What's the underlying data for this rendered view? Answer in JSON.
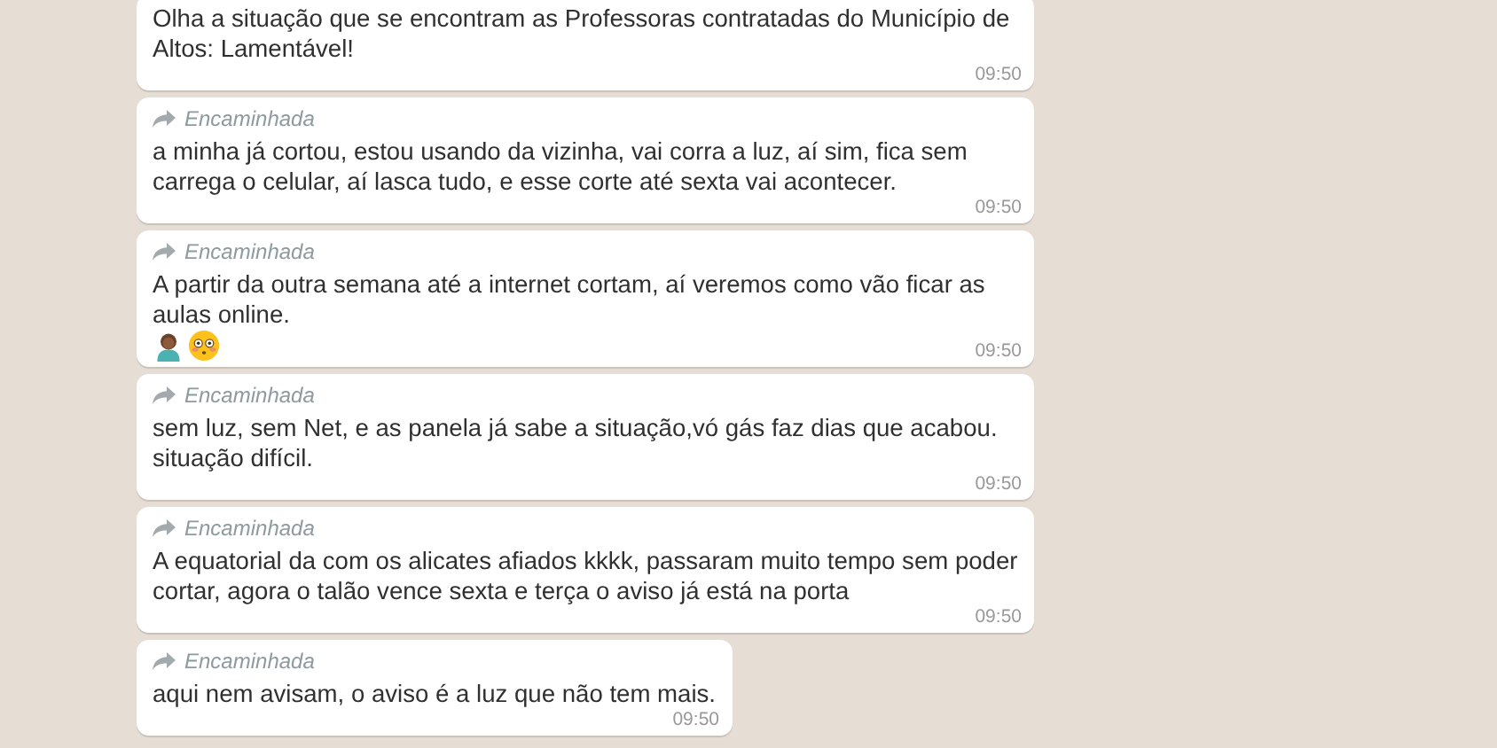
{
  "messages": [
    {
      "forwarded": false,
      "text": "Olha a situação que se encontram as Professoras contratadas do Município de Altos: Lamentável!",
      "time": "09:50",
      "has_emoji": false
    },
    {
      "forwarded": true,
      "forwarded_label": "Encaminhada",
      "text": "a minha já cortou, estou usando da vizinha, vai corra a luz, aí sim, fica sem carrega o celular,  aí lasca tudo, e esse corte até sexta vai acontecer.",
      "time": "09:50",
      "has_emoji": false
    },
    {
      "forwarded": true,
      "forwarded_label": "Encaminhada",
      "text": "A partir da outra semana até a internet cortam, aí veremos como vão ficar as aulas online.",
      "time": "09:50",
      "has_emoji": true
    },
    {
      "forwarded": true,
      "forwarded_label": "Encaminhada",
      "text": "sem luz, sem Net, e as panela já sabe a situação,vó gás faz dias que acabou. situação difícil.",
      "time": "09:50",
      "has_emoji": false
    },
    {
      "forwarded": true,
      "forwarded_label": "Encaminhada",
      "text": "A equatorial da com os alicates afiados kkkk, passaram muito tempo sem poder cortar, agora o talão vence sexta e terça o aviso já está na porta",
      "time": "09:50",
      "has_emoji": false
    },
    {
      "forwarded": true,
      "forwarded_label": "Encaminhada",
      "text": "aqui nem avisam, o aviso é a luz que não tem mais.",
      "time": "09:50",
      "has_emoji": false
    }
  ]
}
